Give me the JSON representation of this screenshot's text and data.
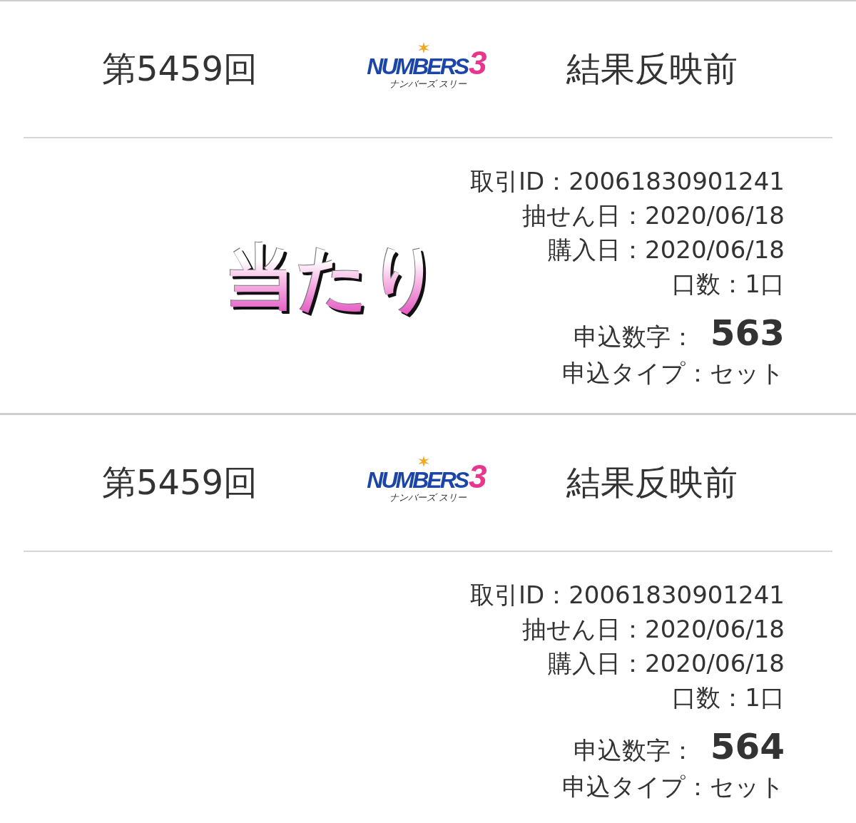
{
  "tickets": [
    {
      "draw": "第5459回",
      "logo": {
        "wordmark": "NUMBERS",
        "digit": "3",
        "reading": "ナンバーズ スリー"
      },
      "status": "結果反映前",
      "result_stamp": "当たり",
      "details": [
        {
          "kind": "plain",
          "label": "取引ID：",
          "value": "20061830901241"
        },
        {
          "kind": "plain",
          "label": "抽せん日：",
          "value": "2020/06/18"
        },
        {
          "kind": "plain",
          "label": "購入日：",
          "value": "2020/06/18"
        },
        {
          "kind": "plain",
          "label": "口数：",
          "value": "1口"
        },
        {
          "kind": "emphasis",
          "label": "申込数字：",
          "value": "563"
        },
        {
          "kind": "plain",
          "label": "申込タイプ：",
          "value": "セット"
        }
      ]
    },
    {
      "draw": "第5459回",
      "logo": {
        "wordmark": "NUMBERS",
        "digit": "3",
        "reading": "ナンバーズ スリー"
      },
      "status": "結果反映前",
      "details": [
        {
          "kind": "plain",
          "label": "取引ID：",
          "value": "20061830901241"
        },
        {
          "kind": "plain",
          "label": "抽せん日：",
          "value": "2020/06/18"
        },
        {
          "kind": "plain",
          "label": "購入日：",
          "value": "2020/06/18"
        },
        {
          "kind": "plain",
          "label": "口数：",
          "value": "1口"
        },
        {
          "kind": "emphasis",
          "label": "申込数字：",
          "value": "564"
        },
        {
          "kind": "plain",
          "label": "申込タイプ：",
          "value": "セット"
        }
      ]
    }
  ]
}
